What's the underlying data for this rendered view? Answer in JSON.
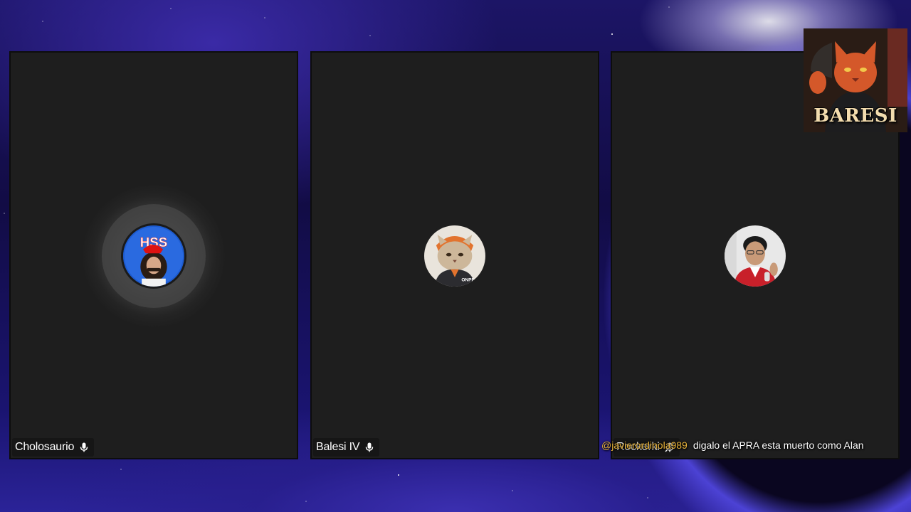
{
  "participants": [
    {
      "name": "Cholosaurio",
      "mic_icon": "microphone-icon",
      "speaking": true,
      "avatar_text": "HSS"
    },
    {
      "name": "Balesi IV",
      "mic_icon": "microphone-icon",
      "speaking": false,
      "avatar_text": "ONPE"
    },
    {
      "name": "Rockerki",
      "mic_icon": "microphone-muted-icon",
      "speaking": false,
      "avatar_text": ""
    }
  ],
  "overlay": {
    "logo_text": "BARESI"
  },
  "chat": {
    "user": "@javierordinola989",
    "message": "digalo el APRA esta muerto como Alan"
  },
  "colors": {
    "tile_bg": "#1e1e1e",
    "chat_user": "#e8b33a",
    "speaking_ring": "#3a3a3a"
  }
}
